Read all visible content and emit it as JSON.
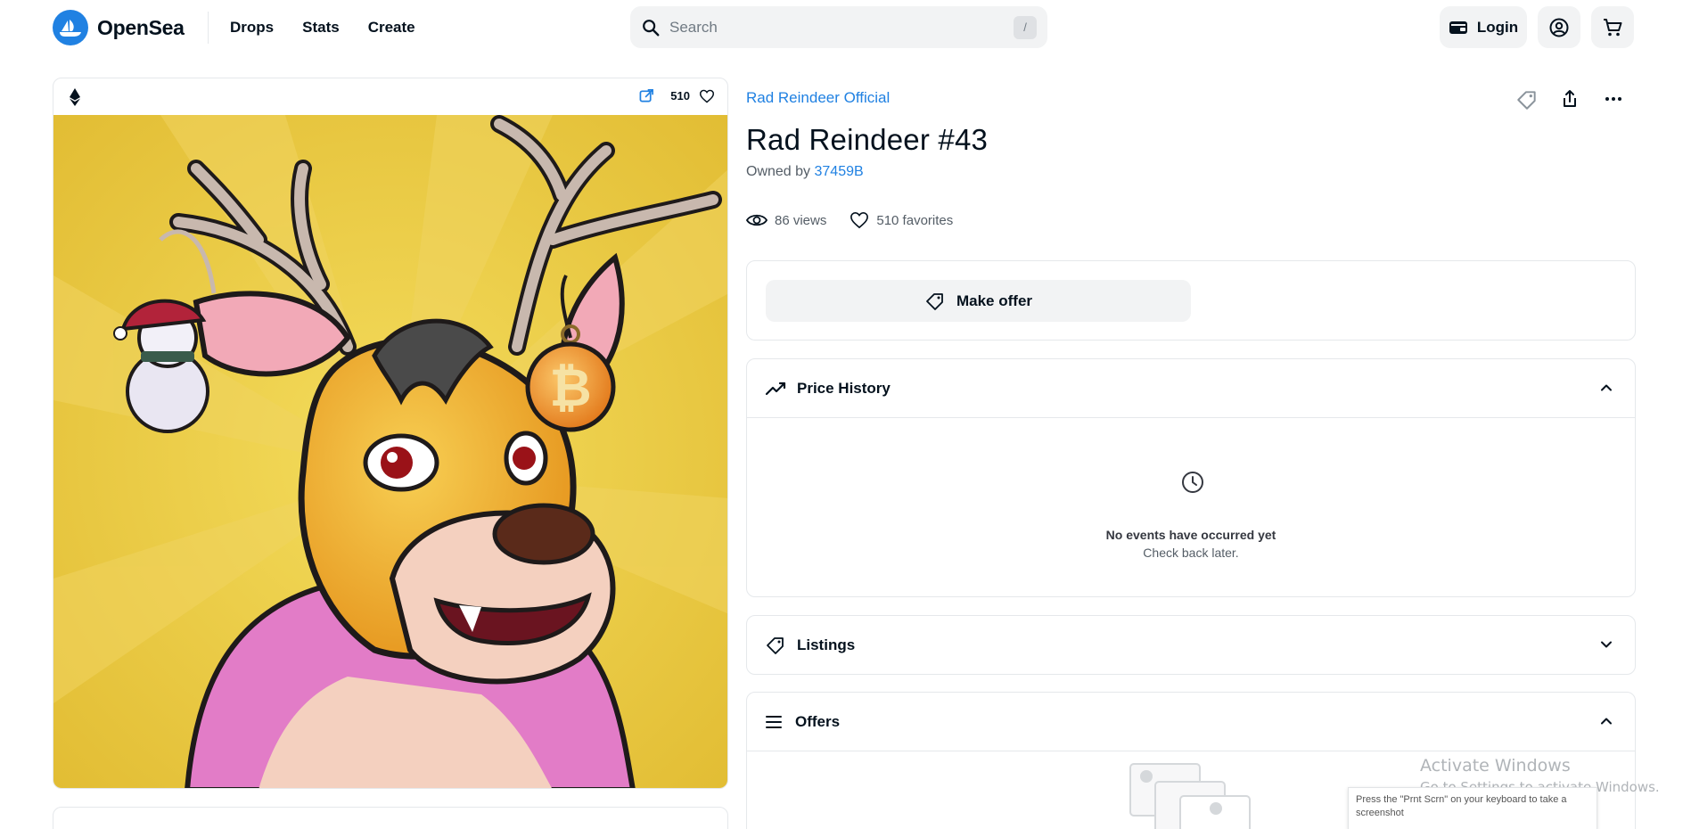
{
  "header": {
    "brand": "OpenSea",
    "nav": [
      "Drops",
      "Stats",
      "Create"
    ],
    "search_placeholder": "Search",
    "search_shortcut": "/",
    "login_label": "Login",
    "icons": [
      "wallet-icon",
      "account-icon",
      "cart-icon",
      "search-icon"
    ]
  },
  "asset_card": {
    "chain_icon": "ethereum-icon",
    "favorites_count": "510",
    "art_subject": "cartoon reindeer with Bitcoin and snowman ornaments"
  },
  "item": {
    "collection": "Rad Reindeer Official",
    "title": "Rad Reindeer #43",
    "owned_by_label": "Owned by",
    "owner": "37459B",
    "views": "86 views",
    "favorites": "510 favorites"
  },
  "offer": {
    "make_offer_label": "Make offer"
  },
  "price_history": {
    "title": "Price History",
    "empty_title": "No events have occurred yet",
    "empty_subtitle": "Check back later."
  },
  "listings": {
    "title": "Listings"
  },
  "offers": {
    "title": "Offers"
  },
  "os_overlay": {
    "activate_title": "Activate Windows",
    "activate_subtitle": "Go to Settings to activate Windows.",
    "prtscr_tip": "Press the \"Prnt Scrn\" on your keyboard to take a screenshot"
  },
  "colors": {
    "brand_blue": "#2081e2",
    "text": "#04111d",
    "muted": "#545d66",
    "panel_bg": "#f2f3f4",
    "art_yellow": "#e8c640"
  }
}
